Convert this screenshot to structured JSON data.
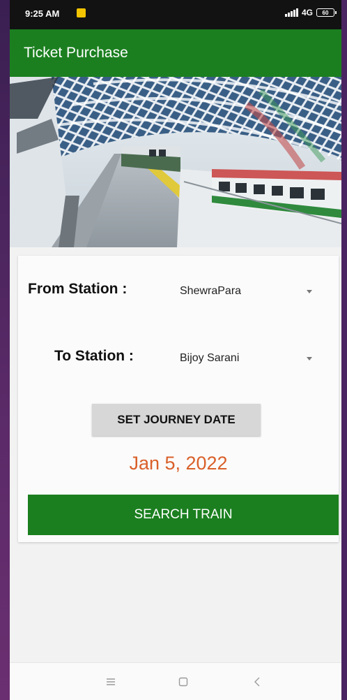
{
  "status_bar": {
    "time": "9:25 AM",
    "network": "4G",
    "battery": "60"
  },
  "app_bar": {
    "title": "Ticket Purchase"
  },
  "form": {
    "from_label": "From Station :",
    "from_value": "ShewraPara",
    "to_label": "To Station :",
    "to_value": "Bijoy Sarani",
    "set_date_label": "SET JOURNEY DATE",
    "journey_date": "Jan 5, 2022",
    "search_label": "SEARCH TRAIN"
  },
  "colors": {
    "primary": "#1b7f1f",
    "date_text": "#d9602a",
    "status_bar": "#121212",
    "date_button": "#d7d7d7"
  },
  "icons": {
    "app_notification": "gallery-icon",
    "signal": "signal-icon",
    "battery": "battery-icon",
    "dropdown": "caret-down-icon",
    "nav_menu": "menu-icon",
    "nav_home": "home-square-icon",
    "nav_back": "back-chevron-icon"
  }
}
